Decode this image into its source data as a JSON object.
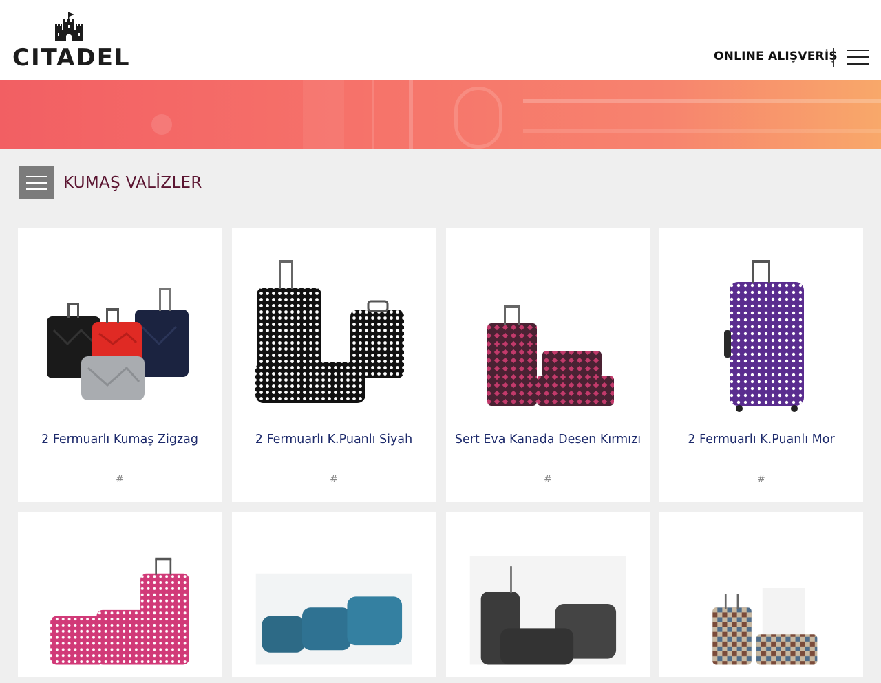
{
  "header": {
    "logo_text": "CITADEL",
    "nav_online": "ONLINE ALIŞVERİŞ",
    "menu_icon": "hamburger-icon"
  },
  "category": {
    "title": "KUMAŞ VALİZLER",
    "toggle_icon": "hamburger-icon"
  },
  "products": [
    {
      "name": "2 Fermuarlı Kumaş Zigzag",
      "link": "#"
    },
    {
      "name": "2 Fermuarlı K.Puanlı Siyah",
      "link": "#"
    },
    {
      "name": "Sert Eva Kanada Desen Kırmızı",
      "link": "#"
    },
    {
      "name": "2 Fermuarlı K.Puanlı Mor",
      "link": "#"
    },
    {
      "name": "",
      "link": ""
    },
    {
      "name": "",
      "link": ""
    },
    {
      "name": "",
      "link": ""
    },
    {
      "name": "",
      "link": ""
    }
  ],
  "colors": {
    "title_color": "#5b1531",
    "product_name_color": "#1d2a6b",
    "banner_start": "#f25f63",
    "banner_end": "#f8a86a"
  }
}
